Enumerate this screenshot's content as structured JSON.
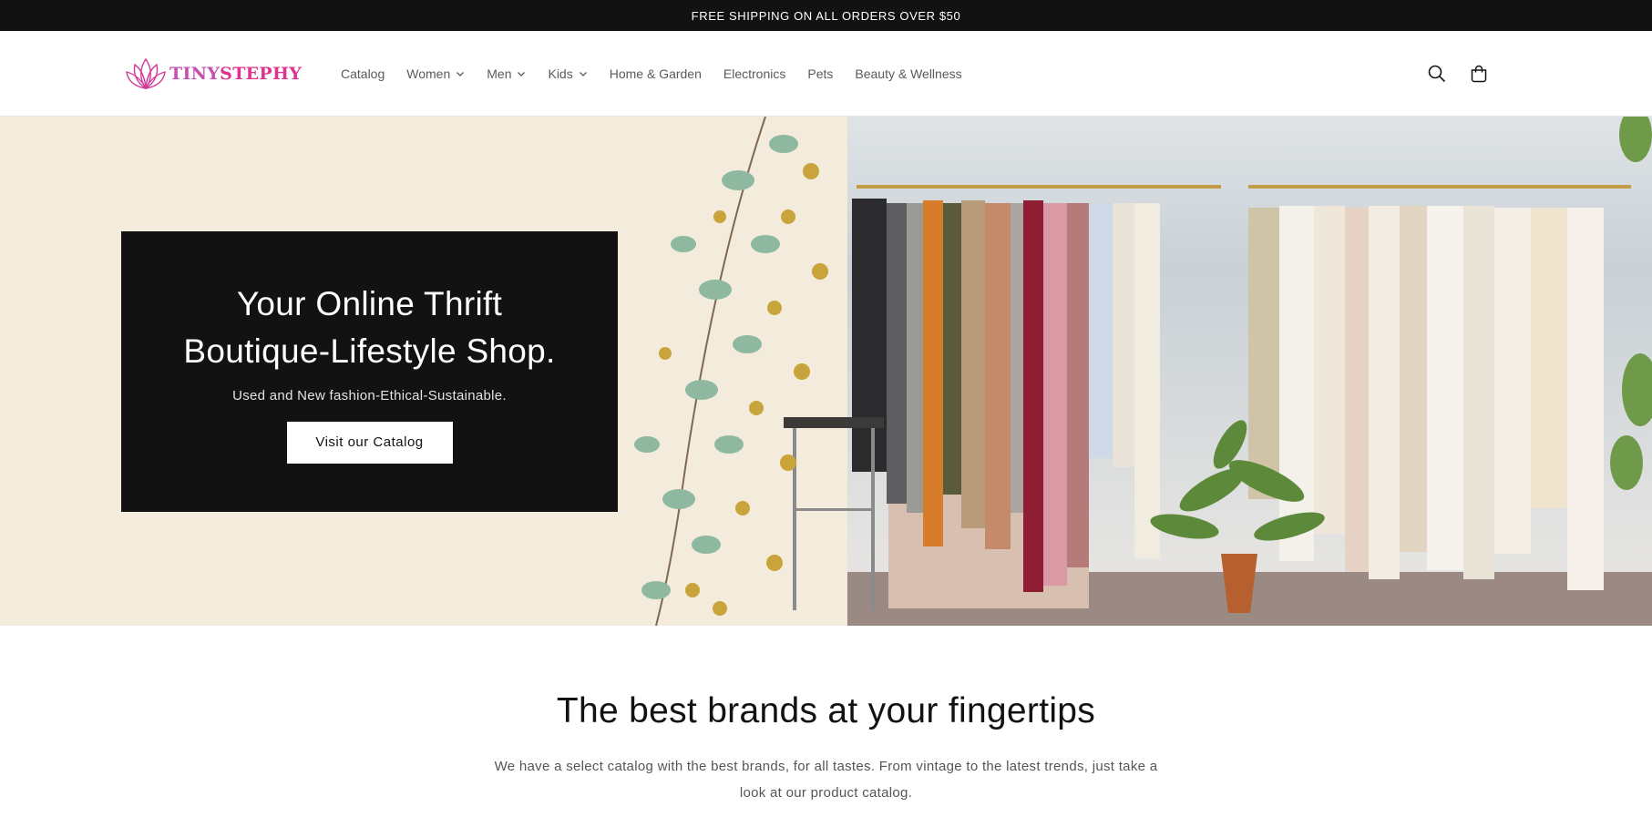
{
  "announcement": "FREE SHIPPING ON ALL ORDERS OVER $50",
  "logo": {
    "part1": "TINY",
    "part2": "STEPHY"
  },
  "nav": [
    {
      "label": "Catalog",
      "dropdown": false
    },
    {
      "label": "Women",
      "dropdown": true
    },
    {
      "label": "Men",
      "dropdown": true
    },
    {
      "label": "Kids",
      "dropdown": true
    },
    {
      "label": "Home & Garden",
      "dropdown": false
    },
    {
      "label": "Electronics",
      "dropdown": false
    },
    {
      "label": "Pets",
      "dropdown": false
    },
    {
      "label": "Beauty & Wellness",
      "dropdown": false
    }
  ],
  "icons": {
    "search": "search-icon",
    "cart": "cart-icon"
  },
  "hero": {
    "title_line1": "Your Online Thrift",
    "title_line2": "Boutique-Lifestyle Shop.",
    "subtitle": "Used and New fashion-Ethical-Sustainable.",
    "button": "Visit our Catalog"
  },
  "brands": {
    "title": "The best brands at your fingertips",
    "text_line1": "We have a select catalog with the best brands, for all tastes. From vintage to the latest trends, just take a",
    "text_line2": "look at our product catalog."
  },
  "colors": {
    "announcement_bg": "#121212",
    "hero_bg": "#f3ecdc",
    "hero_box": "#121212",
    "logo_pink": "#e0338f",
    "logo_purple": "#c84fb0"
  }
}
